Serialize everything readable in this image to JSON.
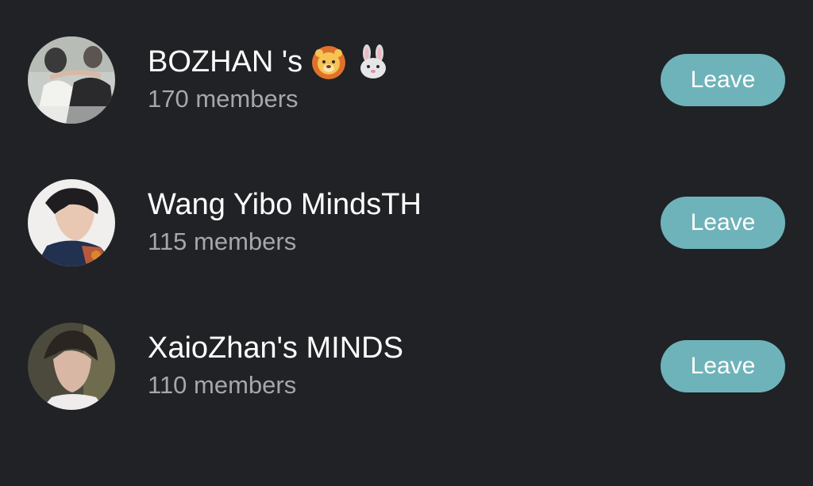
{
  "groups": [
    {
      "name": "BOZHAN 's",
      "emojis": [
        "lion-face-icon",
        "rabbit-face-icon"
      ],
      "members": "170 members",
      "action_label": "Leave"
    },
    {
      "name": "Wang Yibo MindsTH",
      "emojis": [],
      "members": "115 members",
      "action_label": "Leave"
    },
    {
      "name": "XaioZhan's MINDS",
      "emojis": [],
      "members": "110 members",
      "action_label": "Leave"
    }
  ],
  "colors": {
    "background": "#202225",
    "button": "#6eb3ba",
    "title": "#ffffff",
    "subtitle": "#a4a7ab"
  }
}
